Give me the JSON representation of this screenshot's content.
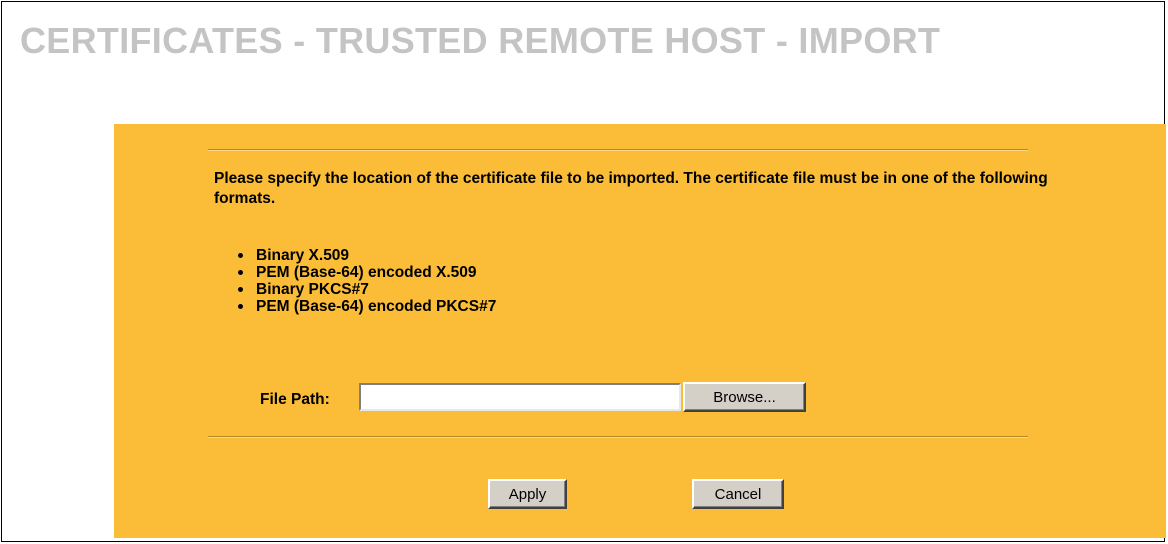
{
  "page": {
    "title": "CERTIFICATES - TRUSTED REMOTE HOST - IMPORT"
  },
  "panel": {
    "instructions": "Please specify the location of the certificate file to be imported. The certificate file must be in one of the following formats.",
    "formats": [
      "Binary X.509",
      "PEM (Base-64) encoded X.509",
      "Binary PKCS#7",
      "PEM (Base-64) encoded PKCS#7"
    ],
    "file_path": {
      "label": "File Path:",
      "value": "",
      "placeholder": ""
    },
    "browse_label": "Browse...",
    "apply_label": "Apply",
    "cancel_label": "Cancel"
  },
  "colors": {
    "panel_background": "#fbbd38",
    "title_text": "#c4c4c4",
    "button_face": "#d4d0c8"
  }
}
